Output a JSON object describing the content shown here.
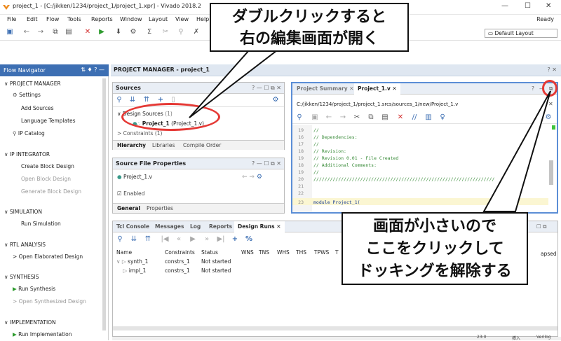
{
  "window": {
    "title": "project_1 - [C:/jikken/1234/project_1/project_1.xpr] - Vivado 2018.2",
    "min": "—",
    "max": "☐",
    "close": "✕"
  },
  "menu": [
    "File",
    "Edit",
    "Flow",
    "Tools",
    "Reports",
    "Window",
    "Layout",
    "View",
    "Help"
  ],
  "status": "Ready",
  "layout_select": "Default Layout",
  "flow_navigator": {
    "title": "Flow Navigator",
    "items": [
      {
        "label": "PROJECT MANAGER",
        "type": "section"
      },
      {
        "label": "Settings",
        "type": "sub"
      },
      {
        "label": "Add Sources",
        "type": "sub"
      },
      {
        "label": "Language Templates",
        "type": "sub"
      },
      {
        "label": "IP Catalog",
        "type": "sub"
      },
      {
        "label": "IP INTEGRATOR",
        "type": "section"
      },
      {
        "label": "Create Block Design",
        "type": "sub"
      },
      {
        "label": "Open Block Design",
        "type": "sub"
      },
      {
        "label": "Generate Block Design",
        "type": "sub"
      },
      {
        "label": "SIMULATION",
        "type": "section"
      },
      {
        "label": "Run Simulation",
        "type": "sub"
      },
      {
        "label": "RTL ANALYSIS",
        "type": "section"
      },
      {
        "label": "Open Elaborated Design",
        "type": "sub"
      },
      {
        "label": "SYNTHESIS",
        "type": "section"
      },
      {
        "label": "Run Synthesis",
        "type": "sub"
      },
      {
        "label": "Open Synthesized Design",
        "type": "sub"
      },
      {
        "label": "IMPLEMENTATION",
        "type": "section"
      },
      {
        "label": "Run Implementation",
        "type": "sub"
      }
    ]
  },
  "pm_header": "PROJECT MANAGER - project_1",
  "sources": {
    "title": "Sources",
    "design_sources": "Design Sources",
    "design_sources_count": "(1)",
    "top": "Project_1",
    "top_file": "(Project_1.v)",
    "constraints": "Constraints",
    "constraints_count": "(1)",
    "tabs": [
      "Hierarchy",
      "Libraries",
      "Compile Order"
    ]
  },
  "sfp": {
    "title": "Source File Properties",
    "file": "Project_1.v",
    "enabled": "Enabled",
    "tabs": [
      "General",
      "Properties"
    ]
  },
  "editor": {
    "tabs": [
      "Project Summary",
      "Project_1.v"
    ],
    "path": "C:/jikken/1234/project_1/project_1.srcs/sources_1/new/Project_1.v",
    "lines": [
      {
        "n": "19",
        "t": "//"
      },
      {
        "n": "16",
        "t": "// Dependencies:"
      },
      {
        "n": "17",
        "t": "//"
      },
      {
        "n": "18",
        "t": "// Revision:"
      },
      {
        "n": "19",
        "t": "// Revision 0.01 - File Created"
      },
      {
        "n": "18",
        "t": "// Additional Comments:"
      },
      {
        "n": "19",
        "t": "//"
      },
      {
        "n": "20",
        "t": "//////////////////////////////////////////////////////////////////"
      },
      {
        "n": "21",
        "t": ""
      },
      {
        "n": "22",
        "t": ""
      },
      {
        "n": "23",
        "t": "module Project_1("
      }
    ]
  },
  "bottom": {
    "tabs": [
      "Tcl Console",
      "Messages",
      "Log",
      "Reports",
      "Design Runs"
    ],
    "columns": [
      "Name",
      "Constraints",
      "Status",
      "WNS",
      "TNS",
      "WHS",
      "THS",
      "TPWS",
      "T"
    ],
    "last_column": "apsed",
    "rows": [
      {
        "name": "synth_1",
        "constraints": "constrs_1",
        "status": "Not started"
      },
      {
        "name": "impl_1",
        "constraints": "constrs_1",
        "status": "Not started"
      }
    ],
    "footer": [
      "23:0",
      "挿入",
      "Verilog"
    ]
  },
  "callouts": {
    "top_line1": "ダブルクリックすると",
    "top_line2": "右の編集画面が開く",
    "bottom_line1": "画面が小さいので",
    "bottom_line2": "ここをクリックして",
    "bottom_line3": "ドッキングを解除する"
  },
  "colors": {
    "accent": "#3d6fb3",
    "highlight_circle": "#e53935"
  }
}
